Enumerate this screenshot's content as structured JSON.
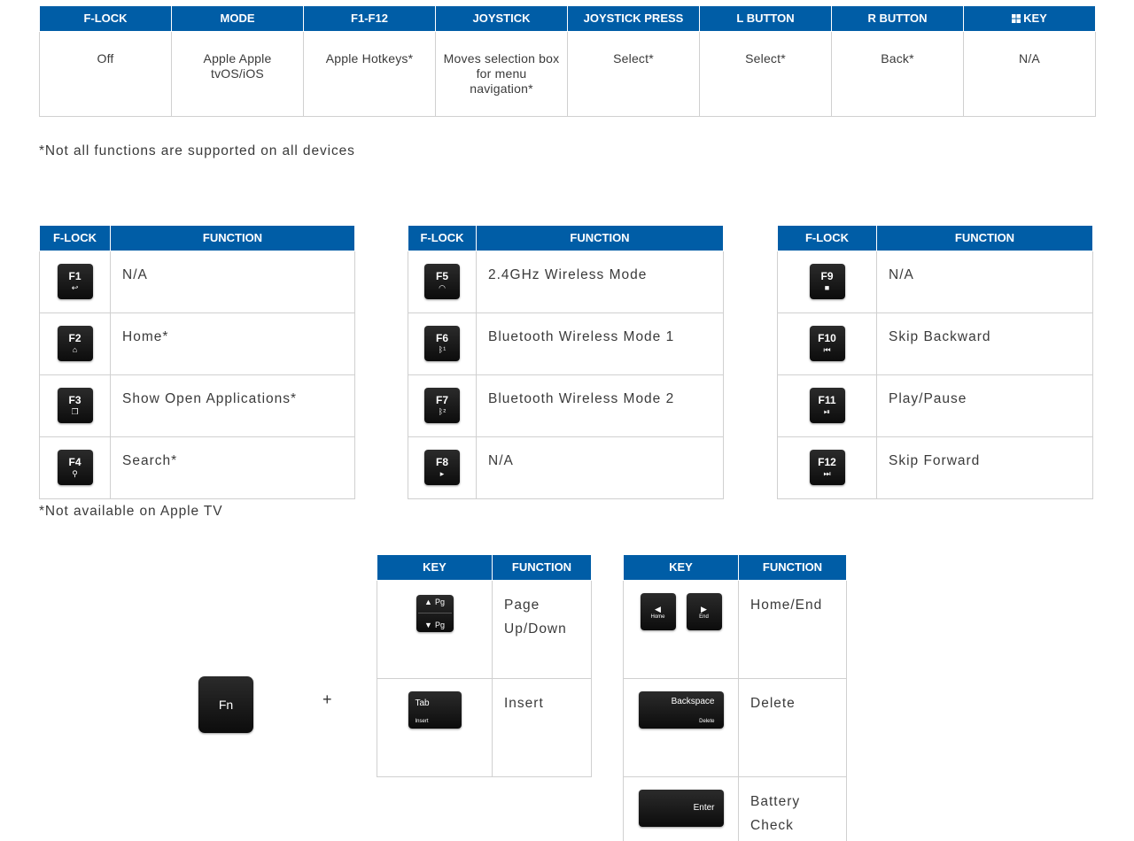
{
  "mode_table": {
    "headers": [
      "F-LOCK",
      "MODE",
      "F1-F12",
      "JOYSTICK",
      "JOYSTICK PRESS",
      "L BUTTON",
      "R BUTTON",
      "KEY"
    ],
    "row": [
      "Off",
      "Apple Apple tvOS/iOS",
      "Apple Hotkeys*",
      "Moves selection box for menu navigation*",
      "Select*",
      "Select*",
      "Back*",
      "N/A"
    ],
    "windows_icon": "windows-logo-icon"
  },
  "note_devices": "*Not all functions are supported on all devices",
  "fkey_tables": [
    {
      "headers": [
        "F-LOCK",
        "FUNCTION"
      ],
      "rows": [
        {
          "key": "F1",
          "symbol": "↩",
          "icon": "back-arrow-icon",
          "function": "N/A"
        },
        {
          "key": "F2",
          "symbol": "⌂",
          "icon": "home-icon",
          "function": "Home*"
        },
        {
          "key": "F3",
          "symbol": "❐",
          "icon": "open-apps-icon",
          "function": "Show Open Applications*"
        },
        {
          "key": "F4",
          "symbol": "⚲",
          "icon": "search-icon",
          "function": "Search*"
        }
      ]
    },
    {
      "headers": [
        "F-LOCK",
        "FUNCTION"
      ],
      "rows": [
        {
          "key": "F5",
          "symbol": "◠",
          "icon": "wireless-icon",
          "function": "2.4GHz Wireless Mode"
        },
        {
          "key": "F6",
          "symbol": "ᛒ¹",
          "icon": "bluetooth-1-icon",
          "function": "Bluetooth Wireless Mode 1"
        },
        {
          "key": "F7",
          "symbol": "ᛒ²",
          "icon": "bluetooth-2-icon",
          "function": "Bluetooth Wireless Mode 2"
        },
        {
          "key": "F8",
          "symbol": "▸",
          "icon": "play-circle-icon",
          "function": "N/A"
        }
      ]
    },
    {
      "headers": [
        "F-LOCK",
        "FUNCTION"
      ],
      "rows": [
        {
          "key": "F9",
          "symbol": "■",
          "icon": "stop-icon",
          "function": "N/A"
        },
        {
          "key": "F10",
          "symbol": "⏮",
          "icon": "skip-backward-icon",
          "function": "Skip Backward"
        },
        {
          "key": "F11",
          "symbol": "⏯",
          "icon": "play-pause-icon",
          "function": "Play/Pause"
        },
        {
          "key": "F12",
          "symbol": "⏭",
          "icon": "skip-forward-icon",
          "function": "Skip Forward"
        }
      ]
    }
  ],
  "note_apple_tv": "*Not available on Apple TV",
  "fn_key": "Fn",
  "plus": "+",
  "combo_table_1": {
    "headers": [
      "KEY",
      "FUNCTION"
    ],
    "rows": [
      {
        "function": "Page Up/Down",
        "key_up": "Pg",
        "key_down": "Pg"
      },
      {
        "function": "Insert",
        "key_main": "Tab",
        "key_sub": "Insert"
      }
    ]
  },
  "combo_table_2": {
    "headers": [
      "KEY",
      "FUNCTION"
    ],
    "rows": [
      {
        "function": "Home/End",
        "key_left": "Home",
        "key_right": "End"
      },
      {
        "function": "Delete",
        "key_main": "Backspace",
        "key_sub": "Delete"
      },
      {
        "function": "Battery Check",
        "key_main": "Enter"
      }
    ]
  }
}
